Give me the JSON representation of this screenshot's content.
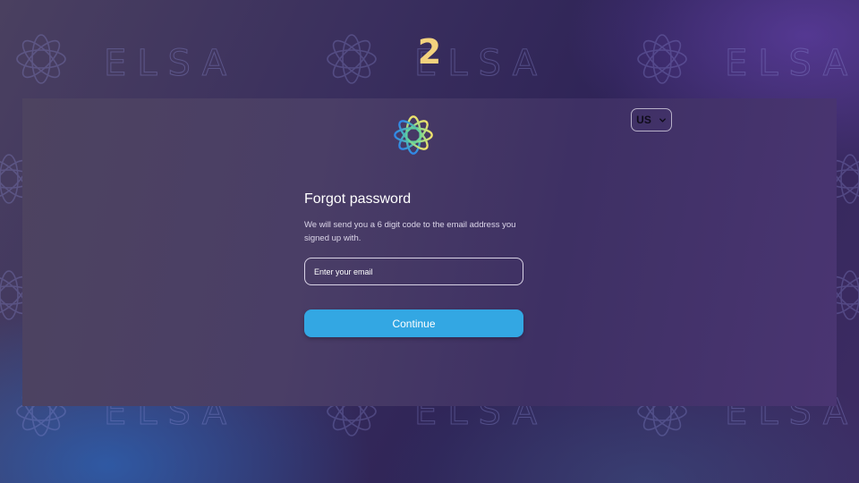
{
  "background": {
    "brand_watermark": "ELSA",
    "watermark_color": "#8e8fd8"
  },
  "step": {
    "number": "2",
    "color": "#f3d27e"
  },
  "header": {
    "logo_icon": "elsa-star-logo-icon",
    "locale": {
      "label": "US",
      "icon": "chevron-down-icon"
    }
  },
  "form": {
    "title": "Forgot password",
    "description": "We will send you a 6 digit code to the email address you signed up with.",
    "email_placeholder": "Enter your email",
    "continue_label": "Continue",
    "accent_color": "#33a7e3"
  }
}
